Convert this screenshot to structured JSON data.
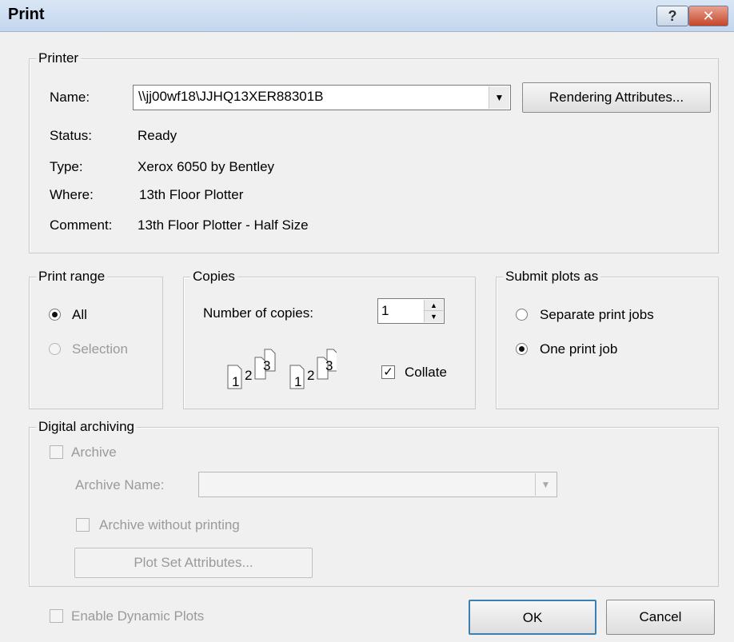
{
  "window": {
    "title": "Print",
    "help_label": "?",
    "close_label": "✕"
  },
  "printer": {
    "legend": "Printer",
    "name_label": "Name:",
    "name_value": "\\\\jj00wf18\\JJHQ13XER88301B",
    "rendering_button": "Rendering Attributes...",
    "status_label": "Status:",
    "status_value": "Ready",
    "type_label": "Type:",
    "type_value": "Xerox 6050 by Bentley",
    "where_label": "Where:",
    "where_value": "13th Floor Plotter",
    "comment_label": "Comment:",
    "comment_value": "13th Floor Plotter - Half Size"
  },
  "print_range": {
    "legend": "Print range",
    "all_label": "All",
    "selection_label": "Selection",
    "selected": "All"
  },
  "copies": {
    "legend": "Copies",
    "number_label": "Number of copies:",
    "number_value": "1",
    "collate_label": "Collate",
    "collate_checked": true,
    "page_numbers": [
      "1",
      "2",
      "3"
    ]
  },
  "submit": {
    "legend": "Submit plots as",
    "separate_label": "Separate print jobs",
    "one_label": "One print job",
    "selected": "One print job"
  },
  "archiving": {
    "legend": "Digital archiving",
    "archive_label": "Archive",
    "archive_name_label": "Archive Name:",
    "archive_name_value": "",
    "without_printing_label": "Archive without printing",
    "plot_set_button": "Plot Set Attributes..."
  },
  "footer": {
    "dynamic_plots_label": "Enable Dynamic Plots",
    "ok_label": "OK",
    "cancel_label": "Cancel"
  },
  "colors": {
    "titlebar": "#c3d6ee",
    "close_button": "#c5462a",
    "disabled_text": "#9a9a9a"
  }
}
